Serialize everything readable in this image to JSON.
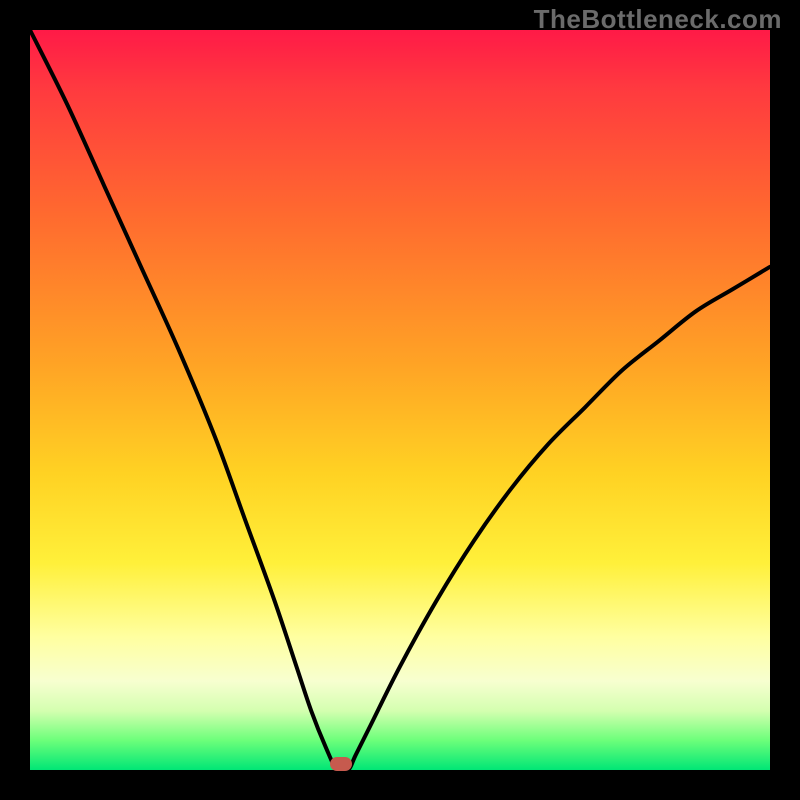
{
  "watermark": "TheBottleneck.com",
  "chart_data": {
    "type": "line",
    "title": "",
    "xlabel": "",
    "ylabel": "",
    "xlim": [
      0,
      100
    ],
    "ylim": [
      0,
      100
    ],
    "series": [
      {
        "name": "bottleneck-curve",
        "x": [
          0,
          5,
          10,
          15,
          20,
          25,
          29,
          33,
          36,
          38,
          40,
          41.5,
          43,
          44,
          46,
          50,
          55,
          60,
          65,
          70,
          75,
          80,
          85,
          90,
          95,
          100
        ],
        "y": [
          100,
          90,
          79,
          68,
          57,
          45,
          34,
          23,
          14,
          8,
          3,
          0,
          0,
          2,
          6,
          14,
          23,
          31,
          38,
          44,
          49,
          54,
          58,
          62,
          65,
          68
        ]
      }
    ],
    "annotations": [
      {
        "name": "min-marker",
        "x": 42,
        "y": 0.8
      }
    ],
    "grid": false,
    "legend": false
  },
  "colors": {
    "curve": "#000000",
    "marker": "#c65a4e",
    "gradient_stops": [
      "#ff1a47",
      "#ff6a2f",
      "#ffd223",
      "#ffffa0",
      "#00e676"
    ]
  }
}
